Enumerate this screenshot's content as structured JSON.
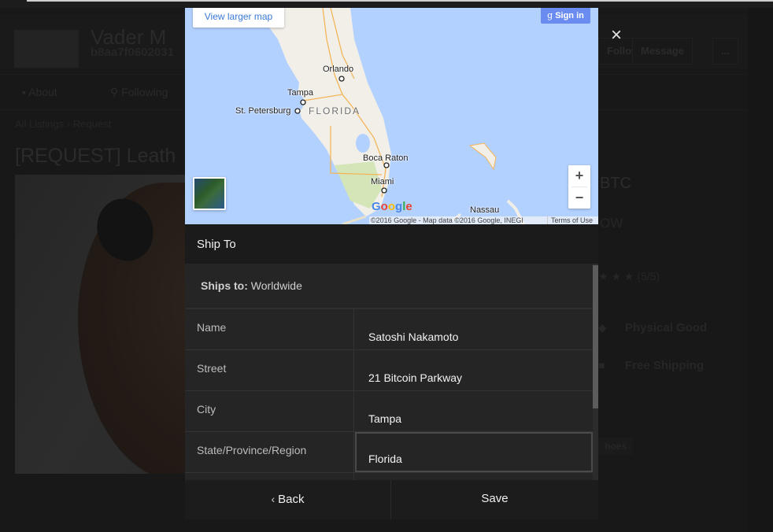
{
  "background_page": {
    "store_name": "Vader M",
    "guid": "b8aa7f0602031",
    "buttons": {
      "follow": "Follow",
      "message": "Message",
      "more": "..."
    },
    "nav": {
      "about": "About",
      "following": "Following"
    },
    "breadcrumb": {
      "root": "All Listings",
      "separator": "›",
      "current": "Request"
    },
    "listing_title": "[REQUEST] Leath",
    "price": "BTC",
    "status": "OW",
    "rating": "★ ★ ★ (5/5)",
    "attributes": [
      {
        "icon": "tag-icon",
        "label": "Physical Good"
      },
      {
        "icon": "box-icon",
        "label": "Free Shipping"
      }
    ],
    "tag": "hoes"
  },
  "modal": {
    "close_label": "×",
    "map": {
      "view_larger": "View larger map",
      "signin_glyph": "g",
      "signin": "Sign in",
      "zoom_in": "+",
      "zoom_out": "−",
      "labels": {
        "orlando": "Orlando",
        "tampa": "Tampa",
        "st_petersburg": "St. Petersburg",
        "florida": "FLORIDA",
        "boca_raton": "Boca Raton",
        "miami": "Miami",
        "nassau": "Nassau"
      },
      "google_logo": [
        "G",
        "o",
        "o",
        "g",
        "l",
        "e"
      ],
      "copyright": "©2016 Google - Map data ©2016 Google, INEGI",
      "terms": "Terms of Use"
    },
    "title": "Ship To",
    "ships_to_label": "Ships to:",
    "ships_to_value": "Worldwide",
    "fields": [
      {
        "label": "Name",
        "value": "Satoshi Nakamoto"
      },
      {
        "label": "Street",
        "value": "21 Bitcoin Parkway"
      },
      {
        "label": "City",
        "value": "Tampa"
      },
      {
        "label": "State/Province/Region",
        "value": "Florida"
      }
    ],
    "back_chevron": "‹",
    "back_label": "Back",
    "save_label": "Save"
  }
}
